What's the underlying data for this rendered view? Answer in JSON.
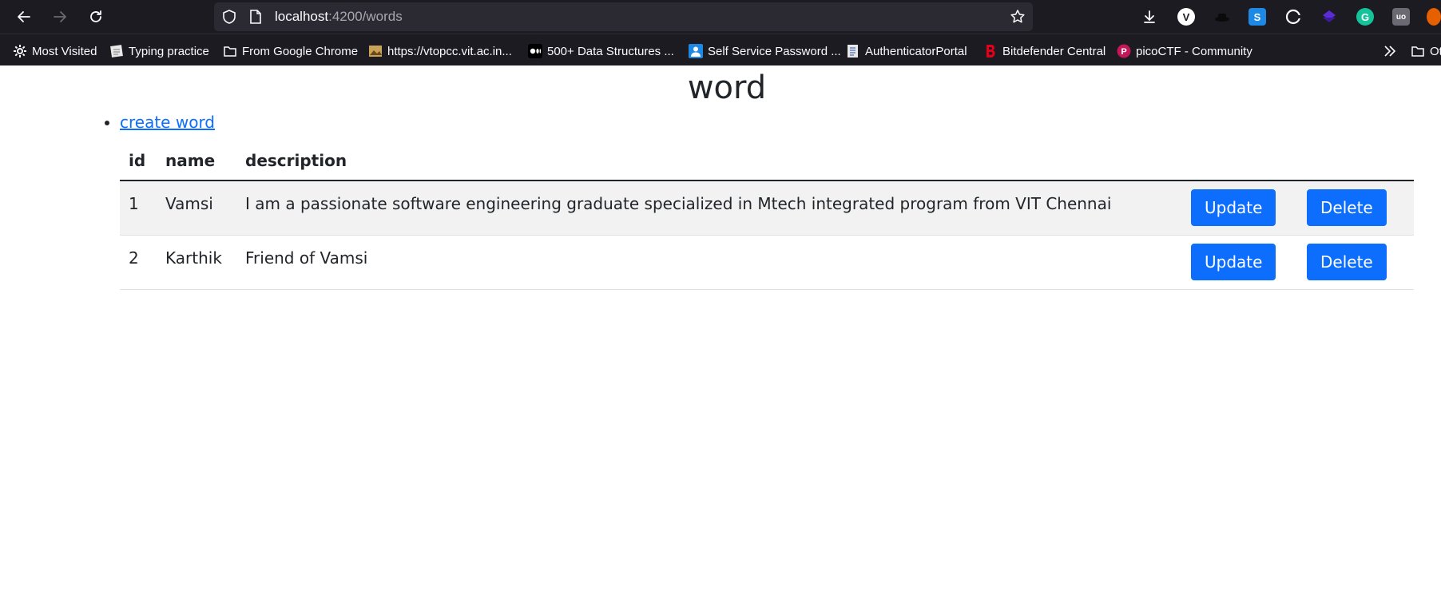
{
  "browser": {
    "url_host": "localhost",
    "url_rest": ":4200/words",
    "bookmarks": [
      {
        "label": "Most Visited",
        "icon": "gear-icon"
      },
      {
        "label": "Typing practice",
        "icon": "keyboard-icon"
      },
      {
        "label": "From Google Chrome",
        "icon": "folder-icon"
      },
      {
        "label": "https://vtopcc.vit.ac.in...",
        "icon": "site-icon"
      },
      {
        "label": "500+ Data Structures ...",
        "icon": "medium-icon"
      },
      {
        "label": "Self Service Password ...",
        "icon": "user-icon"
      },
      {
        "label": "AuthenticatorPortal",
        "icon": "document-icon"
      },
      {
        "label": "Bitdefender Central",
        "icon": "bitdefender-icon"
      },
      {
        "label": "picoCTF - Community",
        "icon": "picoctf-icon"
      }
    ],
    "overflow_label": "Ot"
  },
  "page": {
    "title": "word",
    "create_link": "create word"
  },
  "table": {
    "headers": {
      "id": "id",
      "name": "name",
      "description": "description"
    },
    "rows": [
      {
        "id": "1",
        "name": "Vamsi",
        "description": "I am a passionate software engineering graduate specialized in Mtech integrated program from VIT Chennai",
        "update": "Update",
        "delete": "Delete"
      },
      {
        "id": "2",
        "name": "Karthik",
        "description": "Friend of Vamsi",
        "update": "Update",
        "delete": "Delete"
      }
    ]
  },
  "colors": {
    "chrome_bg": "#1c1b22",
    "urlbar_bg": "#2b2a33",
    "primary": "#0d6efd",
    "stripe": "#f2f2f2"
  }
}
